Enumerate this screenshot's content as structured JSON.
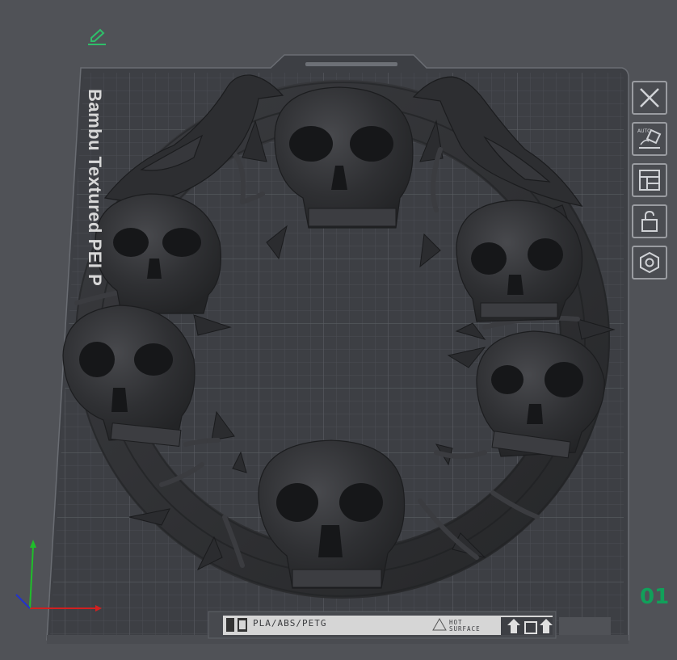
{
  "viewport": {
    "background": "#505257",
    "bed_color": "#3d3f44",
    "grid_color": "#55585e",
    "model_color": "#2f3033"
  },
  "bed": {
    "brand_text": "Bambu Textured PEI P",
    "materials_text": "PLA/ABS/PETG",
    "hot_surface_line1": "HOT",
    "hot_surface_line2": "SURFACE",
    "plate_number": "01",
    "plate_number_color": "#11a05a"
  },
  "plate_tools": [
    {
      "icon": "close-icon",
      "tooltip": "Remove plate"
    },
    {
      "icon": "auto-orient-icon",
      "tooltip": "Auto orient"
    },
    {
      "icon": "arrange-icon",
      "tooltip": "Arrange"
    },
    {
      "icon": "lock-icon",
      "tooltip": "Lock plate"
    },
    {
      "icon": "plate-settings-icon",
      "tooltip": "Plate settings"
    }
  ],
  "axes": {
    "x_color": "#d12020",
    "y_color": "#1fbf2a",
    "z_color": "#2233cc"
  },
  "edit_icon_color": "#2fbf6a"
}
